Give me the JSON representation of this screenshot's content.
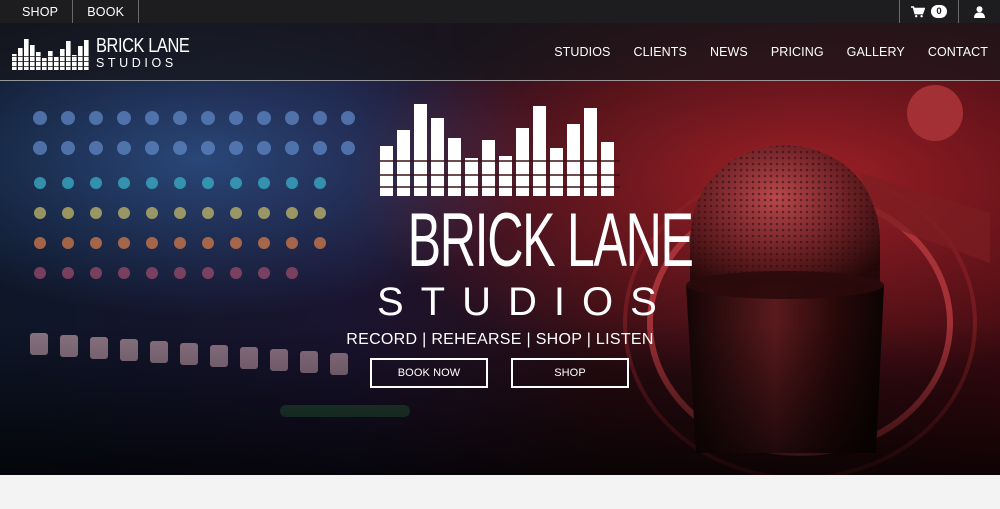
{
  "topbar": {
    "left_links": [
      "SHOP",
      "BOOK"
    ],
    "cart_count": "0",
    "cart_icon": "shopping-cart-icon",
    "user_icon": "user-icon"
  },
  "nav": {
    "logo_line1": "BRICK LANE",
    "logo_line2": "STUDIOS",
    "links": [
      "STUDIOS",
      "CLIENTS",
      "NEWS",
      "PRICING",
      "GALLERY",
      "CONTACT"
    ]
  },
  "hero": {
    "logo_line1": "BRICK LANE",
    "logo_line2": "STUDIOS",
    "tagline": "RECORD | REHEARSE | SHOP | LISTEN",
    "buttons": [
      "BOOK NOW",
      "SHOP"
    ]
  },
  "colors": {
    "topbar_bg": "#1d1d1f",
    "text": "#ffffff",
    "page_bg": "#f3f3f3"
  }
}
